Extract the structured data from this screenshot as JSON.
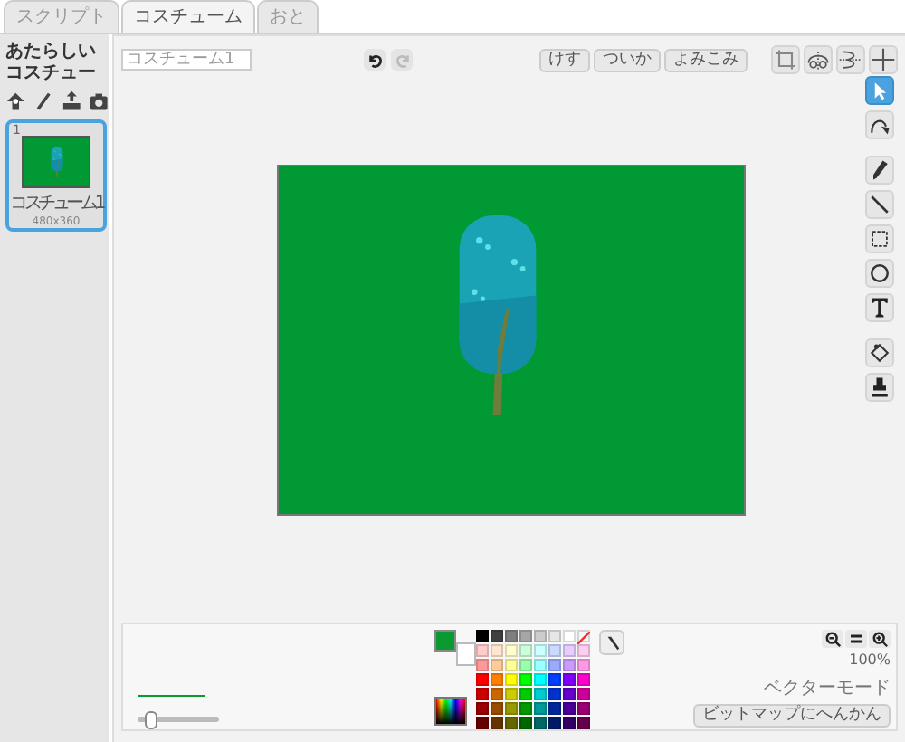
{
  "tabs": [
    {
      "label": "スクリプト",
      "selected": false
    },
    {
      "label": "コスチューム",
      "selected": true
    },
    {
      "label": "おと",
      "selected": false
    }
  ],
  "costume_panel": {
    "new_costume_label": "あたらしいコスチュー",
    "costumes": [
      {
        "number": "1",
        "name": "コスチューム1",
        "size": "480x360",
        "selected": true
      }
    ]
  },
  "editor": {
    "costume_name": "コスチューム1",
    "undo_disabled": false,
    "redo_disabled": true,
    "buttons": [
      "けす",
      "ついか",
      "よみこみ"
    ],
    "top_tools": [
      {
        "kind": "crop"
      },
      {
        "kind": "flip_h"
      },
      {
        "kind": "flip_v"
      },
      {
        "kind": "center"
      }
    ],
    "tools": [
      {
        "kind": "select",
        "selected": true
      },
      {
        "kind": "reshape",
        "selected": false
      },
      {
        "kind": "pencil",
        "selected": false
      },
      {
        "kind": "line",
        "selected": false
      },
      {
        "kind": "rect",
        "selected": false
      },
      {
        "kind": "ellipse",
        "selected": false
      },
      {
        "kind": "text",
        "selected": false
      },
      {
        "kind": "fill",
        "selected": false
      },
      {
        "kind": "stamp",
        "selected": false
      }
    ],
    "color_swatches": [
      {
        "kind": "primary",
        "color": "#0b9a32"
      },
      {
        "kind": "secondary",
        "color": "#ffffff"
      }
    ],
    "palette": [
      [
        {
          "color": "#000000"
        },
        {
          "color": "#404040"
        },
        {
          "color": "#7f7f7f"
        },
        {
          "color": "#a6a6a6"
        },
        {
          "color": "#cccccc"
        },
        {
          "color": "#e6e6e6"
        },
        {
          "color": "#ffffff"
        },
        {
          "kind": "none"
        }
      ],
      [
        {
          "color": "#ffcccc"
        },
        {
          "color": "#ffe6cc"
        },
        {
          "color": "#ffffcc"
        },
        {
          "color": "#ccffd9"
        },
        {
          "color": "#ccffff"
        },
        {
          "color": "#ccd9ff"
        },
        {
          "color": "#e6ccff"
        },
        {
          "color": "#ffccf2"
        }
      ],
      [
        {
          "color": "#ff9999"
        },
        {
          "color": "#ffcc99"
        },
        {
          "color": "#ffff99"
        },
        {
          "color": "#99ffaa"
        },
        {
          "color": "#99ffff"
        },
        {
          "color": "#99aaff"
        },
        {
          "color": "#cc99ff"
        },
        {
          "color": "#ff99e6"
        }
      ],
      [
        {
          "color": "#ff0000"
        },
        {
          "color": "#ff8000"
        },
        {
          "color": "#ffff00"
        },
        {
          "color": "#00ff00"
        },
        {
          "color": "#00ffff"
        },
        {
          "color": "#0040ff"
        },
        {
          "color": "#8000ff"
        },
        {
          "color": "#ff00cc"
        }
      ],
      [
        {
          "color": "#cc0000"
        },
        {
          "color": "#cc6600"
        },
        {
          "color": "#cccc00"
        },
        {
          "color": "#00cc00"
        },
        {
          "color": "#00cccc"
        },
        {
          "color": "#0033cc"
        },
        {
          "color": "#6600cc"
        },
        {
          "color": "#cc0099"
        }
      ],
      [
        {
          "color": "#990000"
        },
        {
          "color": "#994c00"
        },
        {
          "color": "#999900"
        },
        {
          "color": "#009900"
        },
        {
          "color": "#009999"
        },
        {
          "color": "#002699"
        },
        {
          "color": "#4c0099"
        },
        {
          "color": "#990073"
        }
      ],
      [
        {
          "color": "#660000"
        },
        {
          "color": "#663300"
        },
        {
          "color": "#666600"
        },
        {
          "color": "#006600"
        },
        {
          "color": "#006666"
        },
        {
          "color": "#001a66"
        },
        {
          "color": "#330066"
        },
        {
          "color": "#66004d"
        }
      ]
    ],
    "line_width": {
      "level": 0.15
    },
    "zoom_level": "100%",
    "mode_label": "ベクターモード",
    "convert_button": "ビットマップにへんかん"
  }
}
